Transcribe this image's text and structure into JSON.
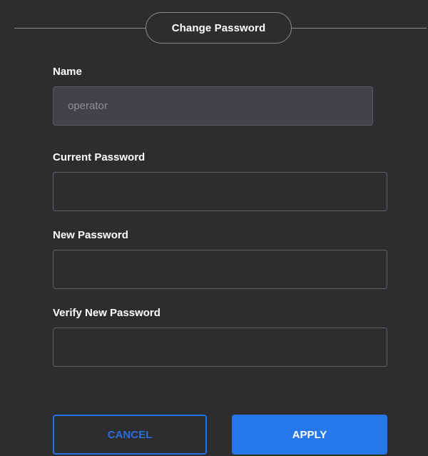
{
  "dialog": {
    "title": "Change Password"
  },
  "fields": {
    "name": {
      "label": "Name",
      "value": "operator"
    },
    "current_password": {
      "label": "Current Password",
      "value": ""
    },
    "new_password": {
      "label": "New Password",
      "value": ""
    },
    "verify_new_password": {
      "label": "Verify New Password",
      "value": ""
    }
  },
  "buttons": {
    "cancel_label": "CANCEL",
    "apply_label": "APPLY"
  },
  "colors": {
    "panel_background": "#2d2d2f",
    "accent": "#2577ea",
    "text": "#ffffff",
    "muted_text": "#8e8e93"
  }
}
